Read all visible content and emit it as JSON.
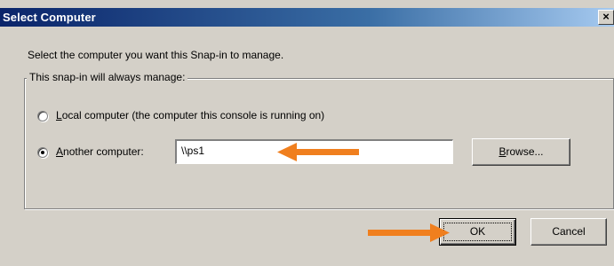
{
  "window": {
    "title": "Select Computer",
    "close_glyph": "×"
  },
  "instruction": "Select the computer you want this Snap-in to manage.",
  "group": {
    "label": "This snap-in will always manage:",
    "local_option": {
      "accel": "L",
      "label_rest": "ocal computer  (the computer this console is running on)",
      "selected": false
    },
    "another_option": {
      "accel": "A",
      "label_rest": "nother computer:",
      "selected": true
    },
    "computer_name": "\\\\ps1",
    "browse": {
      "accel": "B",
      "label_rest": "rowse..."
    }
  },
  "buttons": {
    "ok": "OK",
    "cancel": "Cancel"
  },
  "annotations": {
    "arrow_color": "#f07f1e"
  },
  "colors": {
    "dialog_bg": "#d4d0c8",
    "title_start": "#0a246a",
    "title_end": "#a6caf0"
  }
}
